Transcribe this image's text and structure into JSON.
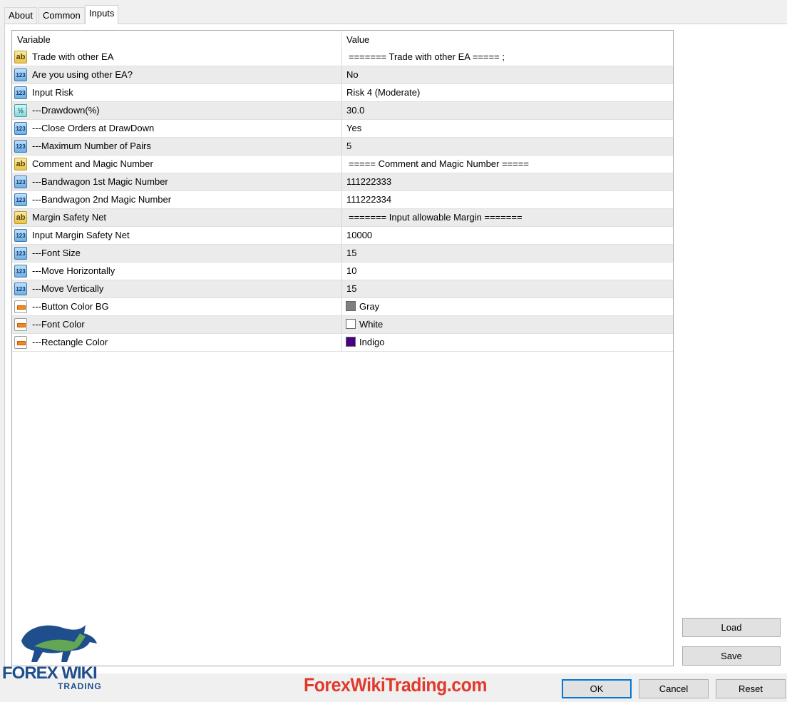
{
  "tabs": [
    "About",
    "Common",
    "Inputs"
  ],
  "grid": {
    "headers": {
      "variable": "Variable",
      "value": "Value"
    },
    "rows": [
      {
        "icon": "ab",
        "variable": "Trade with other EA",
        "value": "======= Trade with other EA ===== ;"
      },
      {
        "icon": "123",
        "variable": "Are you using other EA?",
        "value": "No"
      },
      {
        "icon": "123",
        "variable": "Input Risk",
        "value": "Risk 4 (Moderate)"
      },
      {
        "icon": "1/2",
        "variable": "---Drawdown(%)",
        "value": "30.0"
      },
      {
        "icon": "123",
        "variable": "---Close Orders at DrawDown",
        "value": "Yes"
      },
      {
        "icon": "123",
        "variable": "---Maximum Number of Pairs",
        "value": "5"
      },
      {
        "icon": "ab",
        "variable": "Comment and Magic Number",
        "value": "===== Comment and Magic Number ====="
      },
      {
        "icon": "123",
        "variable": "---Bandwagon 1st Magic Number",
        "value": "111222333"
      },
      {
        "icon": "123",
        "variable": "---Bandwagon 2nd Magic Number",
        "value": "111222334"
      },
      {
        "icon": "ab",
        "variable": "Margin Safety Net",
        "value": "=======  Input allowable Margin ======="
      },
      {
        "icon": "123",
        "variable": "Input Margin Safety Net",
        "value": "10000"
      },
      {
        "icon": "123",
        "variable": "---Font Size",
        "value": "15"
      },
      {
        "icon": "123",
        "variable": "---Move Horizontally",
        "value": "10"
      },
      {
        "icon": "123",
        "variable": "---Move Vertically",
        "value": "15"
      },
      {
        "icon": "color",
        "variable": "---Button Color BG",
        "value": "Gray",
        "swatch": "#808080"
      },
      {
        "icon": "color",
        "variable": "---Font Color",
        "value": "White",
        "swatch": "#ffffff"
      },
      {
        "icon": "color",
        "variable": "---Rectangle Color",
        "value": "Indigo",
        "swatch": "#4b0082"
      }
    ]
  },
  "buttons": {
    "load": "Load",
    "save": "Save",
    "ok": "OK",
    "cancel": "Cancel",
    "reset": "Reset"
  },
  "logo": {
    "brand": "FOREX WIKI",
    "sub": "TRADING"
  },
  "watermark": "ForexWikiTrading.com",
  "colors": {
    "accent": "#0078d7",
    "watermark": "#e03a2e",
    "logo_blue": "#1f4e8c",
    "logo_green": "#6ab04c"
  }
}
